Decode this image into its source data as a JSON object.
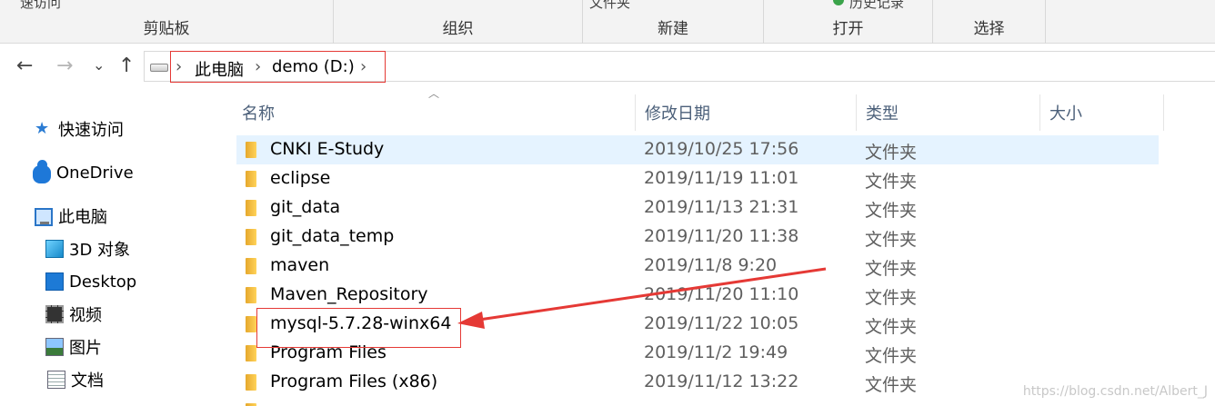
{
  "ribbon": {
    "cut_top_left": "速访问",
    "cut_top_mid": "文件夹",
    "cut_top_right": "历史记录",
    "groups": [
      {
        "label": "剪贴板"
      },
      {
        "label": "组织"
      },
      {
        "label": "新建"
      },
      {
        "label": "打开"
      },
      {
        "label": "选择"
      }
    ]
  },
  "nav": {
    "back": "←",
    "forward": "→",
    "recent": "⌄",
    "up": "↑"
  },
  "address": {
    "crumbs": [
      "此电脑",
      "demo (D:)"
    ],
    "separator": "›"
  },
  "sidebar": {
    "items": [
      {
        "label": "快速访问",
        "icon": "star-icon"
      },
      {
        "label": "OneDrive",
        "icon": "cloud-icon"
      },
      {
        "label": "此电脑",
        "icon": "computer-icon"
      },
      {
        "label": "3D 对象",
        "icon": "cube-icon"
      },
      {
        "label": "Desktop",
        "icon": "desktop-icon"
      },
      {
        "label": "视频",
        "icon": "video-icon"
      },
      {
        "label": "图片",
        "icon": "picture-icon"
      },
      {
        "label": "文档",
        "icon": "document-icon"
      }
    ]
  },
  "columns": {
    "name": "名称",
    "modified": "修改日期",
    "type": "类型",
    "size": "大小"
  },
  "files": [
    {
      "name": "CNKI E-Study",
      "modified": "2019/10/25 17:56",
      "type": "文件夹"
    },
    {
      "name": "eclipse",
      "modified": "2019/11/19 11:01",
      "type": "文件夹"
    },
    {
      "name": "git_data",
      "modified": "2019/11/13 21:31",
      "type": "文件夹"
    },
    {
      "name": "git_data_temp",
      "modified": "2019/11/20 11:38",
      "type": "文件夹"
    },
    {
      "name": "maven",
      "modified": "2019/11/8 9:20",
      "type": "文件夹"
    },
    {
      "name": "Maven_Repository",
      "modified": "2019/11/20 11:10",
      "type": "文件夹"
    },
    {
      "name": "mysql-5.7.28-winx64",
      "modified": "2019/11/22 10:05",
      "type": "文件夹"
    },
    {
      "name": "Program Files",
      "modified": "2019/11/2 19:49",
      "type": "文件夹"
    },
    {
      "name": "Program Files (x86)",
      "modified": "2019/11/12 13:22",
      "type": "文件夹"
    }
  ],
  "watermark": "https://blog.csdn.net/Albert_J",
  "colors": {
    "annotation_red": "#e53935",
    "selection": "#e5f3ff",
    "folder": "#ffd35a"
  }
}
